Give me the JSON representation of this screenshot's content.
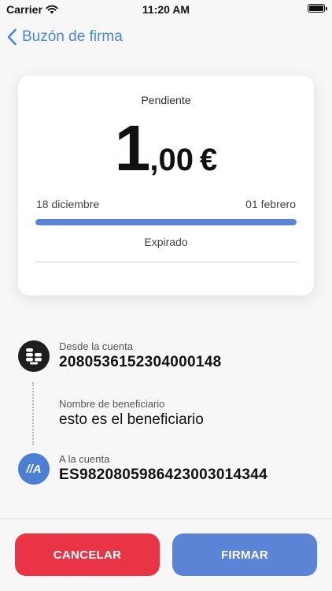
{
  "status_bar": {
    "carrier": "Carrier",
    "time": "11:20 AM"
  },
  "nav": {
    "back_title": "Buzón de firma"
  },
  "card": {
    "status": "Pendiente",
    "amount_integer": "1",
    "amount_decimal": ",00",
    "currency": "€",
    "date_start": "18 diciembre",
    "date_end": "01 febrero",
    "progress": 1.0,
    "expired_label": "Expirado"
  },
  "details": {
    "from": {
      "label": "Desde la cuenta",
      "value": "2080536152304000148",
      "icon": "bank-icon"
    },
    "beneficiary": {
      "label": "Nombre de beneficiario",
      "value": "esto es el beneficiario"
    },
    "to": {
      "label": "A la cuenta",
      "value": "ES9820805986423003014344",
      "icon": "abanca-logo-icon",
      "icon_text": "//A"
    }
  },
  "actions": {
    "cancel": "CANCELAR",
    "sign": "FIRMAR"
  },
  "colors": {
    "accent": "#4a86d8",
    "progress": "#5b84d6",
    "cancel": "#e93445",
    "sign": "#5b84d6"
  }
}
